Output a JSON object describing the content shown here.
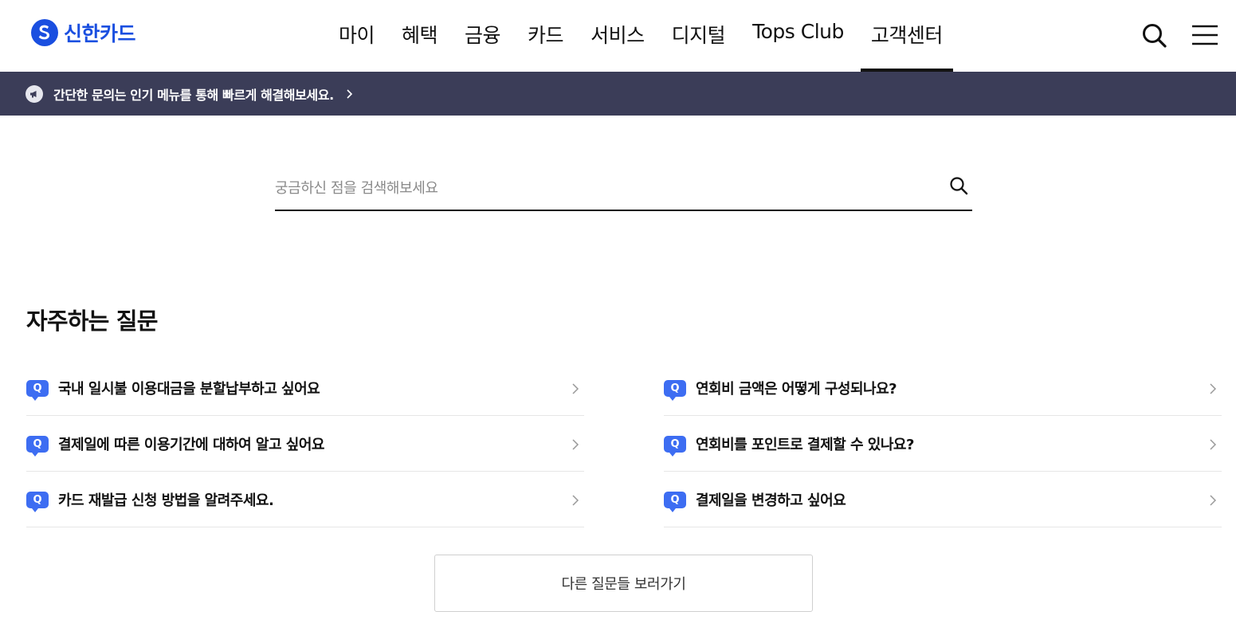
{
  "brand": {
    "name": "신한카드",
    "color": "#1a4fe0"
  },
  "nav": {
    "items": [
      {
        "label": "마이"
      },
      {
        "label": "혜택"
      },
      {
        "label": "금융"
      },
      {
        "label": "카드"
      },
      {
        "label": "서비스"
      },
      {
        "label": "디지털"
      },
      {
        "label": "Tops Club"
      },
      {
        "label": "고객센터",
        "active": true
      }
    ],
    "search_icon": "search-icon",
    "menu_icon": "hamburger-menu-icon"
  },
  "notice": {
    "icon": "megaphone-icon",
    "text": "간단한 문의는 인기 메뉴를 통해 빠르게 해결해보세요.",
    "background": "#3b3d58"
  },
  "search": {
    "placeholder": "궁금하신 점을 검색해보세요",
    "value": ""
  },
  "faq": {
    "title": "자주하는 질문",
    "badge": "Q",
    "badge_color": "#3d6df2",
    "left": [
      {
        "question": "국내 일시불 이용대금을 분할납부하고 싶어요"
      },
      {
        "question": "결제일에 따른 이용기간에 대하여 알고 싶어요"
      },
      {
        "question": "카드 재발급 신청 방법을 알려주세요."
      }
    ],
    "right": [
      {
        "question": "연회비 금액은 어떻게 구성되나요?"
      },
      {
        "question": "연회비를 포인트로 결제할 수 있나요?"
      },
      {
        "question": "결제일을 변경하고 싶어요"
      }
    ],
    "more_label": "다른 질문들 보러가기"
  }
}
